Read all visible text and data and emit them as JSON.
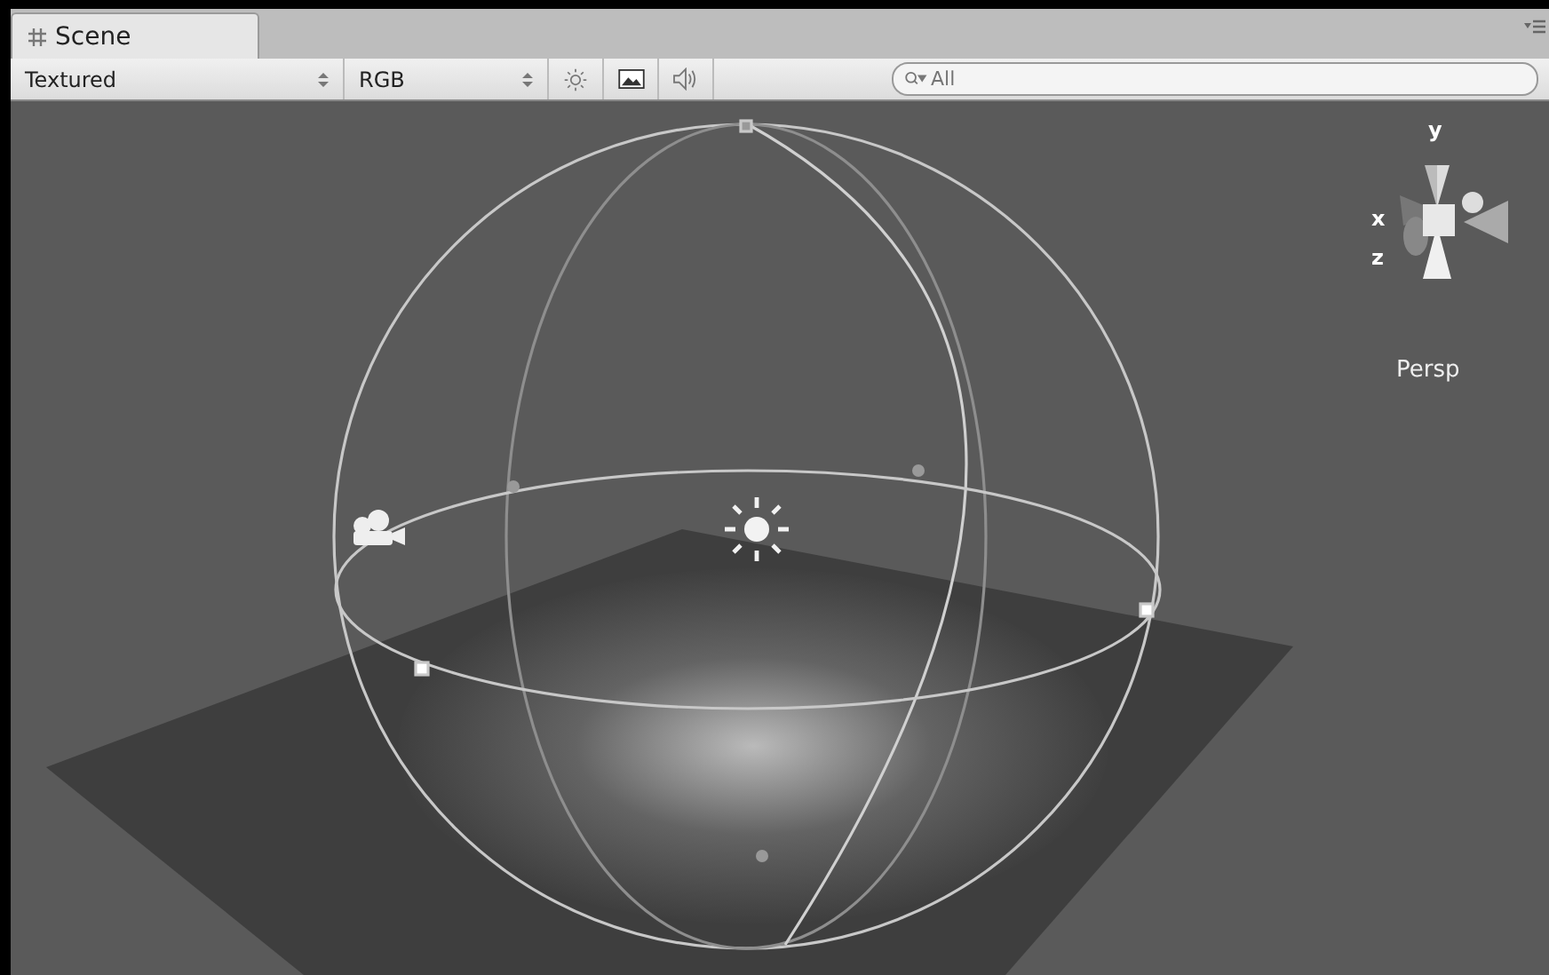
{
  "tab": {
    "label": "Scene",
    "selected": true
  },
  "toolbar": {
    "draw_mode": "Textured",
    "render_mode": "RGB",
    "toggles": [
      {
        "kind": "lighting"
      },
      {
        "kind": "image"
      },
      {
        "kind": "audio"
      }
    ],
    "search": {
      "placeholder": "All"
    }
  },
  "gizmo": {
    "axes": [
      "y",
      "x",
      "z"
    ],
    "projection": "Persp"
  }
}
